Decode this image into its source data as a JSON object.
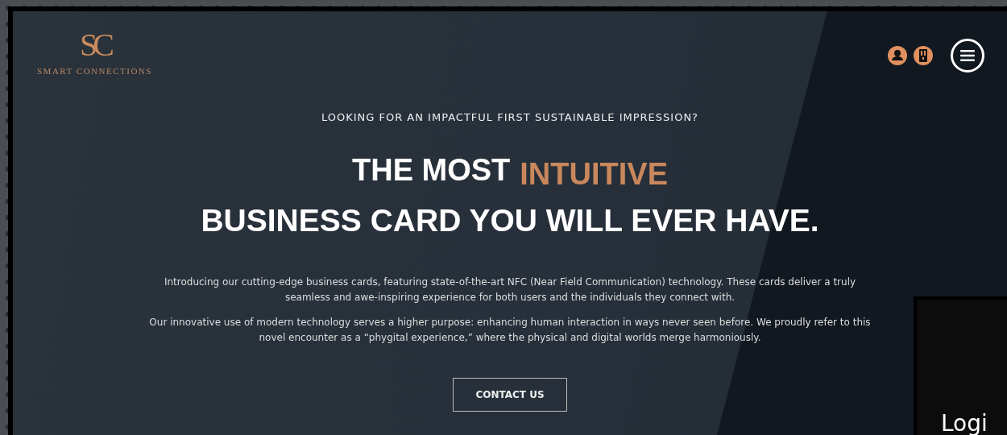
{
  "header": {
    "logo_mark": "SC",
    "logo_text": "SMART CONNECTIONS"
  },
  "hero": {
    "eyebrow": "LOOKING FOR AN IMPACTFUL FIRST SUSTAINABLE IMPRESSION?",
    "headline_lead": "THE MOST",
    "headline_highlight": "INTUITIVE",
    "headline_rest": "BUSINESS CARD YOU WILL EVER HAVE.",
    "paragraphs": [
      "Introducing our cutting-edge business cards, featuring state-of-the-art NFC (Near Field Communication) technology. These cards deliver a truly seamless and awe-inspiring experience for both users and the individuals they connect with.",
      "Our innovative use of modern technology serves a higher purpose: enhancing human interaction in ways never seen before. We proudly refer to this novel encounter as a “phygital experience,” where the physical and digital worlds merge harmoniously."
    ],
    "button": "CONTACT US"
  },
  "login_panel": {
    "title": "Logi"
  }
}
